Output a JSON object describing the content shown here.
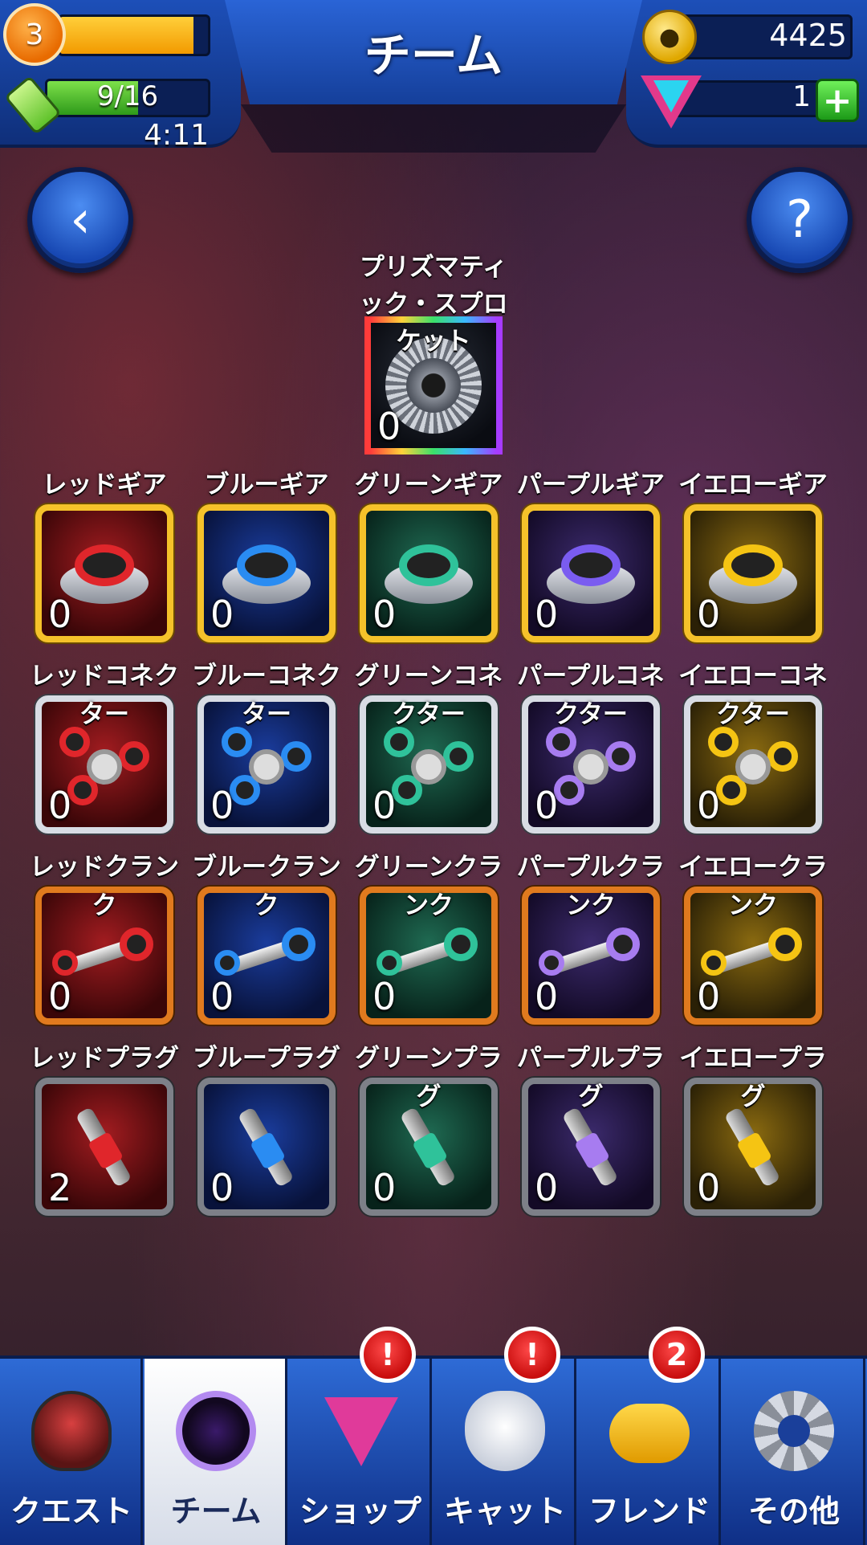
{
  "header": {
    "title": "チーム",
    "level": "3",
    "xp_progress": 0.9,
    "energy": "9/16",
    "energy_progress": 0.5625,
    "energy_timer": "4:11",
    "coins": "4425",
    "gems": "1",
    "gem_add_label": "+"
  },
  "buttons": {
    "back_label": "‹",
    "help_label": "?"
  },
  "special_item": {
    "name": "プリズマティック・スプロケット",
    "count": "0"
  },
  "items": [
    {
      "name": "レッドギア",
      "count": "0",
      "color": "#e0262b"
    },
    {
      "name": "ブルーギア",
      "count": "0",
      "color": "#2a8cf2"
    },
    {
      "name": "グリーンギア",
      "count": "0",
      "color": "#2fc29a"
    },
    {
      "name": "パープルギア",
      "count": "0",
      "color": "#7a5cf0"
    },
    {
      "name": "イエローギア",
      "count": "0",
      "color": "#f5c413"
    },
    {
      "name": "レッドコネクター",
      "count": "0",
      "color": "#e0262b"
    },
    {
      "name": "ブルーコネクター",
      "count": "0",
      "color": "#2a8cf2"
    },
    {
      "name": "グリーンコネクター",
      "count": "0",
      "color": "#2fc29a"
    },
    {
      "name": "パープルコネクター",
      "count": "0",
      "color": "#a77cf0"
    },
    {
      "name": "イエローコネクター",
      "count": "0",
      "color": "#f5c413"
    },
    {
      "name": "レッドクランク",
      "count": "0",
      "color": "#e0262b"
    },
    {
      "name": "ブルークランク",
      "count": "0",
      "color": "#2a8cf2"
    },
    {
      "name": "グリーンクランク",
      "count": "0",
      "color": "#2fc29a"
    },
    {
      "name": "パープルクランク",
      "count": "0",
      "color": "#a77cf0"
    },
    {
      "name": "イエロークランク",
      "count": "0",
      "color": "#f5c413"
    },
    {
      "name": "レッドプラグ",
      "count": "2",
      "color": "#e0262b"
    },
    {
      "name": "ブループラグ",
      "count": "0",
      "color": "#2a8cf2"
    },
    {
      "name": "グリーンプラグ",
      "count": "0",
      "color": "#2fc29a"
    },
    {
      "name": "パープルプラグ",
      "count": "0",
      "color": "#a77cf0"
    },
    {
      "name": "イエロープラグ",
      "count": "0",
      "color": "#f5c413"
    }
  ],
  "nav": [
    {
      "label": "クエスト",
      "icon": "quest-robot-icon",
      "badge": ""
    },
    {
      "label": "チーム",
      "icon": "team-helmet-icon",
      "badge": ""
    },
    {
      "label": "ショップ",
      "icon": "shop-gem-icon",
      "badge": "!"
    },
    {
      "label": "キャット",
      "icon": "cat-icon",
      "badge": "!"
    },
    {
      "label": "フレンド",
      "icon": "friend-chat-icon",
      "badge": "2"
    },
    {
      "label": "その他",
      "icon": "settings-gear-icon",
      "badge": ""
    }
  ]
}
